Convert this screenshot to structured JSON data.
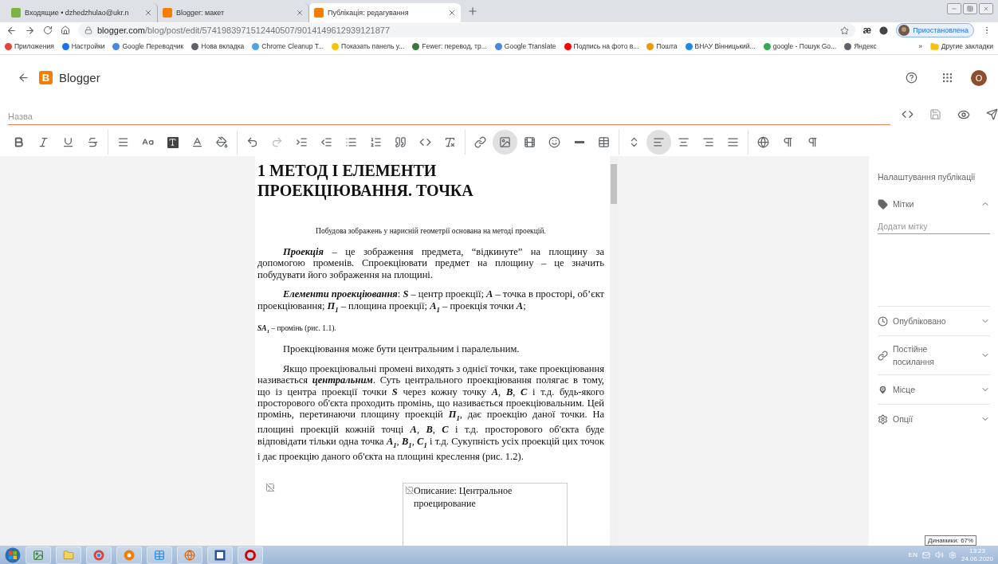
{
  "browser": {
    "tabs": [
      {
        "kind": "mail",
        "title": "Входящие • dzhedzhulao@ukr.n",
        "selected": false
      },
      {
        "kind": "blogger",
        "title": "Blogger: макет",
        "selected": false
      },
      {
        "kind": "blogger",
        "title": "Публікація: редагування",
        "selected": true
      }
    ],
    "address": {
      "host": "blogger.com",
      "path": "/blog/post/edit/5741983971512440507/9014149612939121877"
    },
    "extension_text": "æ",
    "profile": "Приостановлена",
    "bookmarks": [
      {
        "title": "Приложения",
        "color": "#e94235"
      },
      {
        "title": "Настройки",
        "color": "#1a73e8"
      },
      {
        "title": "Google Переводчик",
        "color": "#4a86e8"
      },
      {
        "title": "Нова вкладка",
        "color": "#5f6368"
      },
      {
        "title": "Chrome Cleanup T...",
        "color": "#4fa3e0"
      },
      {
        "title": "Показать панель у...",
        "color": "#f4c20d"
      },
      {
        "title": "Fewer: перевод, тр...",
        "color": "#3c763d"
      },
      {
        "title": "Google Translate",
        "color": "#4a86e8"
      },
      {
        "title": "Подпись на фото в...",
        "color": "#ff0000"
      },
      {
        "title": "Пошта",
        "color": "#f29900"
      },
      {
        "title": "ВНАУ Вінницький...",
        "color": "#1e88e5"
      },
      {
        "title": "google - Пошук Go...",
        "color": "#34a853"
      },
      {
        "title": "Яндекс",
        "color": "#5f6368"
      }
    ],
    "more": "»",
    "other_bookmarks": "Другие закладки"
  },
  "app": {
    "logo_letter": "B",
    "name": "Blogger",
    "avatar_letter": "O"
  },
  "editor": {
    "title_placeholder": "Назва",
    "toolbar": [
      [
        {
          "kind": "bold",
          "selected": false
        },
        {
          "kind": "italic",
          "selected": false
        },
        {
          "kind": "underline",
          "selected": false
        },
        {
          "kind": "strikethrough",
          "selected": false
        }
      ],
      [
        {
          "kind": "paragraph",
          "selected": false
        },
        {
          "kind": "font-size",
          "selected": false
        },
        {
          "kind": "text-background",
          "selected": false
        },
        {
          "kind": "text-color",
          "selected": false
        },
        {
          "kind": "highlight",
          "selected": false
        }
      ],
      [
        {
          "kind": "undo",
          "selected": false
        },
        {
          "kind": "redo",
          "selected": false
        },
        {
          "kind": "indent",
          "selected": false
        },
        {
          "kind": "outdent",
          "selected": false
        },
        {
          "kind": "bullets",
          "selected": false
        },
        {
          "kind": "numbers",
          "selected": false
        },
        {
          "kind": "quote",
          "selected": false
        },
        {
          "kind": "code",
          "selected": false
        },
        {
          "kind": "clear",
          "selected": false
        }
      ],
      [
        {
          "kind": "link",
          "selected": false
        },
        {
          "kind": "image",
          "selected": true
        },
        {
          "kind": "video",
          "selected": false
        },
        {
          "kind": "emoji",
          "selected": false
        },
        {
          "kind": "rule",
          "selected": false
        },
        {
          "kind": "table",
          "selected": false
        }
      ],
      [
        {
          "kind": "spacing",
          "selected": false
        },
        {
          "kind": "align-left",
          "selected": true
        },
        {
          "kind": "align-center",
          "selected": false
        },
        {
          "kind": "align-right",
          "selected": false
        },
        {
          "kind": "justify",
          "selected": false
        }
      ],
      [
        {
          "kind": "language",
          "selected": false
        },
        {
          "kind": "ltr",
          "selected": false
        },
        {
          "kind": "rtl",
          "selected": false
        }
      ]
    ],
    "document": {
      "heading": "1  МЕТОД  І  ЕЛЕМЕНТИ ПРОЕКЦІЮВАННЯ. ТОЧКА",
      "paragraphs": [
        {
          "kind": "lead",
          "text": "Побудова зображень у нарисній геометрії основана на методі проекцій."
        },
        {
          "kind": "body",
          "text": "**Проекція** – це зображення предмета, “відкинуте” на площину за допомогою променів. Спроекціювати предмет на площину – це значить побудувати його зображення на площині."
        },
        {
          "kind": "body",
          "text": "**Елементи проекціювання**: **S** – центр проекції; **A** – точка в просторі, об’єкт проекціювання; **П**$_{1}$ – площина проекції; **A**$_{1}$ – проекція точки **A**;"
        },
        {
          "kind": "note",
          "text": "**SA**$_{1}$ – промінь (рис. 1.1)."
        },
        {
          "kind": "body",
          "text": "Проекціювання може бути центральним і паралельним."
        },
        {
          "kind": "body",
          "text": "Якщо проекціювальні промені виходять з однієї точки, таке проекціювання називається **центральним**.  Суть центрального проекціювання полягає в тому, що із центра проекції точки  **S**  через кожну точку **A**, **B**, **C**  і т.д. будь-якого просторового об'єкта проходить промінь, що називається проекціювальним. Цей промінь, перетинаючи площину проекцій **П**$_{1}$, дає проекцію даної точки. На площині проекцій кожній точці **A**, **B**, **C** і т.д. просторового об'єкта буде відповідати тільки одна точка **A**$_{1}$, **B**$_{1}$, **C**$_{1}$  і т.д. Сукупність усіх проекцій цих точок і дає проекцію даного об'єкта на площині креслення (рис. 1.2)."
        }
      ],
      "image_alt": "Описание: Центральное проецирование"
    }
  },
  "settings": {
    "title": "Налаштування публікації",
    "label_placeholder": "Додати мітку",
    "sections": [
      {
        "kind": "labels",
        "title": "Мітки",
        "expanded": true
      },
      {
        "kind": "published",
        "title": "Опубліковано",
        "expanded": false
      },
      {
        "kind": "permalink",
        "title": "Постійне посилання",
        "expanded": false
      },
      {
        "kind": "location",
        "title": "Місце",
        "expanded": false
      },
      {
        "kind": "options",
        "title": "Опції",
        "expanded": false
      }
    ]
  },
  "taskbar": {
    "tooltip": "Динамики: 67%",
    "language": "EN",
    "time": "13:23",
    "date": "24.06.2020"
  }
}
